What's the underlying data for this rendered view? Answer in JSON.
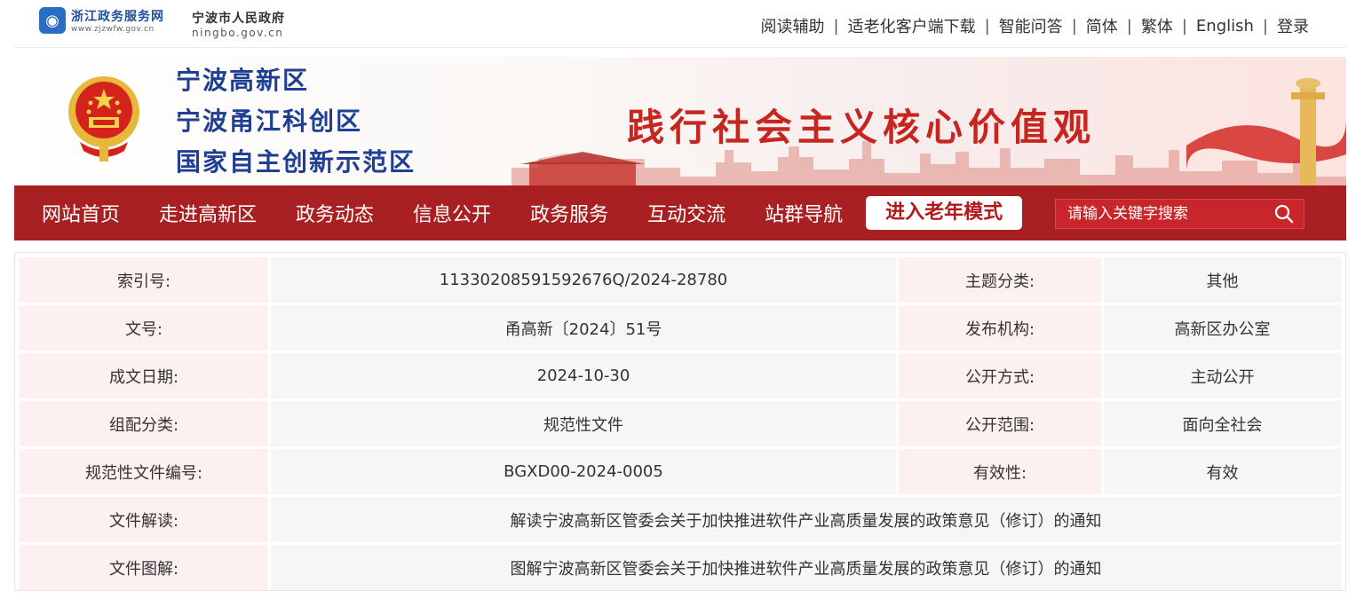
{
  "topbar": {
    "zj_logo_title": "浙江政务服务网",
    "zj_logo_url": "www.zjzwfw.gov.cn",
    "nb_logo_title": "宁波市人民政府",
    "nb_logo_url": "ningbo.gov.cn",
    "links": [
      "阅读辅助",
      "适老化客户端下载",
      "智能问答",
      "简体",
      "繁体",
      "English",
      "登录"
    ]
  },
  "banner": {
    "names": [
      "宁波高新区",
      "宁波甬江科创区",
      "国家自主创新示范区"
    ],
    "slogan": "践行社会主义核心价值观"
  },
  "nav": {
    "items": [
      "网站首页",
      "走进高新区",
      "政务动态",
      "信息公开",
      "政务服务",
      "互动交流",
      "站群导航"
    ],
    "elder_mode": "进入老年模式",
    "search_placeholder": "请输入关键字搜索"
  },
  "info": {
    "rows4": [
      {
        "k1": "索引号:",
        "v1": "11330208591592676Q/2024-28780",
        "k2": "主题分类:",
        "v2": "其他"
      },
      {
        "k1": "文号:",
        "v1": "甬高新〔2024〕51号",
        "k2": "发布机构:",
        "v2": "高新区办公室"
      },
      {
        "k1": "成文日期:",
        "v1": "2024-10-30",
        "k2": "公开方式:",
        "v2": "主动公开"
      },
      {
        "k1": "组配分类:",
        "v1": "规范性文件",
        "k2": "公开范围:",
        "v2": "面向全社会"
      },
      {
        "k1": "规范性文件编号:",
        "v1": "BGXD00-2024-0005",
        "k2": "有效性:",
        "v2": "有效"
      }
    ],
    "rows2": [
      {
        "k": "文件解读:",
        "v": "解读宁波高新区管委会关于加快推进软件产业高质量发展的政策意见（修订）的通知"
      },
      {
        "k": "文件图解:",
        "v": "图解宁波高新区管委会关于加快推进软件产业高质量发展的政策意见（修订）的通知"
      }
    ]
  }
}
